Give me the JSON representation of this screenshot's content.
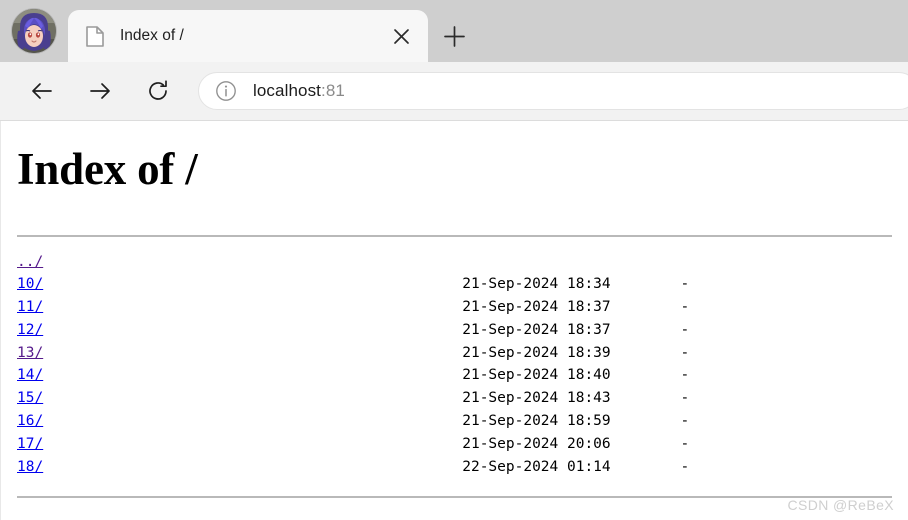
{
  "browser": {
    "avatar": {
      "name": "user-avatar",
      "description": "anime character with purple hair"
    },
    "tab": {
      "favicon": "document-icon",
      "title": "Index of /",
      "close_label": "✕"
    },
    "new_tab_label": "＋",
    "toolbar": {
      "back_label": "←",
      "forward_label": "→",
      "reload_label": "↻",
      "info_icon": "info-circle-icon",
      "url_host": "localhost",
      "url_port": ":81",
      "url_full": "localhost:81"
    },
    "colors": {
      "tabstrip_bg": "#cfcfcf",
      "tab_bg": "#f7f7f7",
      "toolbar_bg": "#f2f2f2",
      "urlbar_bg": "#ffffff",
      "link": "#0000ee",
      "link_visited": "#551a8b",
      "rule": "#b9b9b9",
      "watermark": "#cfcfcf"
    }
  },
  "page": {
    "heading": "Index of /",
    "parent": {
      "label": "../",
      "visited": true,
      "date": "",
      "size": ""
    },
    "entries": [
      {
        "label": "10/",
        "visited": false,
        "date": "21-Sep-2024 18:34",
        "size": "-"
      },
      {
        "label": "11/",
        "visited": false,
        "date": "21-Sep-2024 18:37",
        "size": "-"
      },
      {
        "label": "12/",
        "visited": false,
        "date": "21-Sep-2024 18:37",
        "size": "-"
      },
      {
        "label": "13/",
        "visited": true,
        "date": "21-Sep-2024 18:39",
        "size": "-"
      },
      {
        "label": "14/",
        "visited": false,
        "date": "21-Sep-2024 18:40",
        "size": "-"
      },
      {
        "label": "15/",
        "visited": false,
        "date": "21-Sep-2024 18:43",
        "size": "-"
      },
      {
        "label": "16/",
        "visited": false,
        "date": "21-Sep-2024 18:59",
        "size": "-"
      },
      {
        "label": "17/",
        "visited": false,
        "date": "21-Sep-2024 20:06",
        "size": "-"
      },
      {
        "label": "18/",
        "visited": false,
        "date": "22-Sep-2024 01:14",
        "size": "-"
      }
    ],
    "watermark": "CSDN @ReBeX"
  }
}
